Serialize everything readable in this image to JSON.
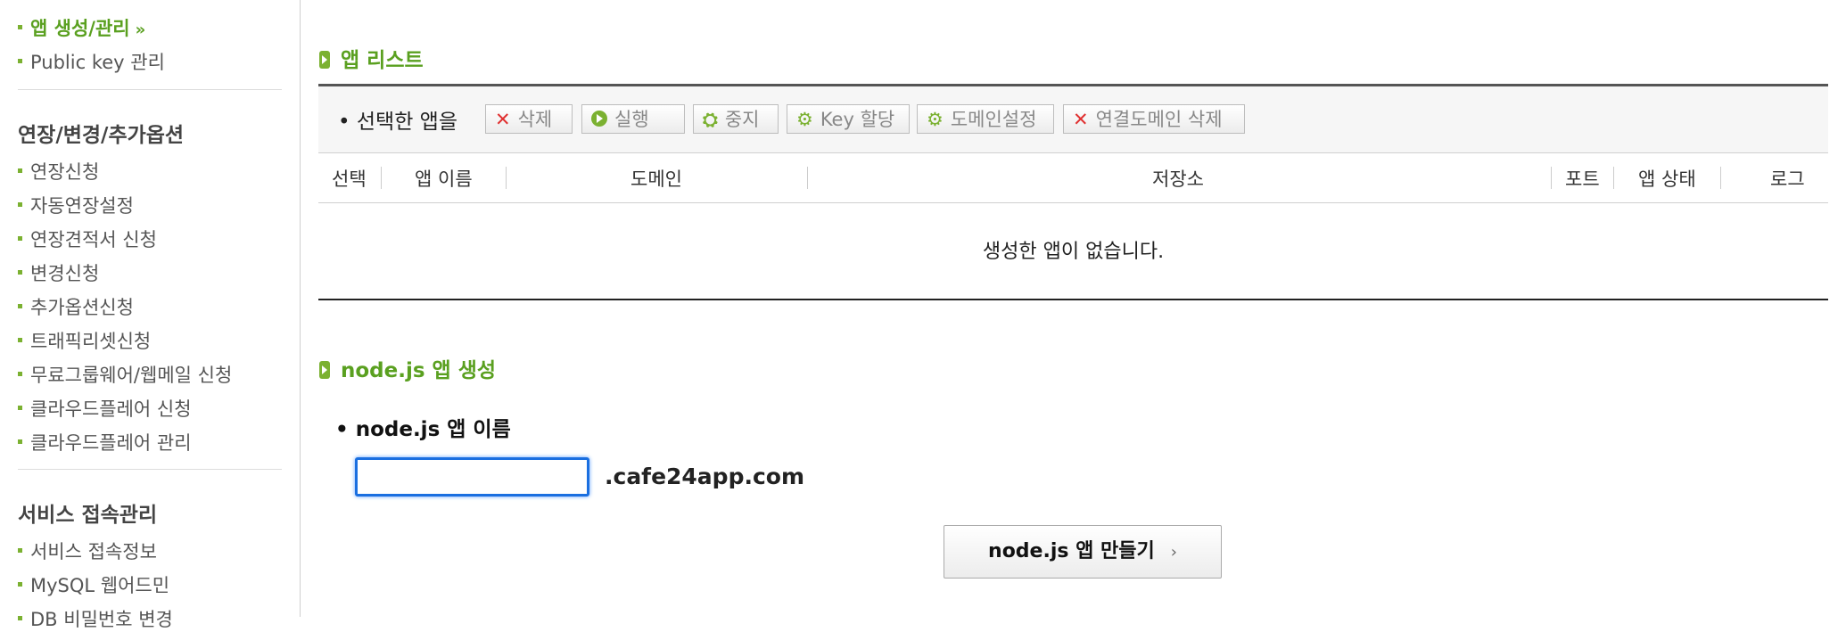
{
  "sidebar": {
    "items_top": [
      {
        "label": "앱 생성/관리",
        "active": true,
        "arrow": "»"
      },
      {
        "label": "Public key 관리",
        "active": false
      }
    ],
    "section2_title": "연장/변경/추가옵션",
    "section2_items": [
      {
        "label": "연장신청"
      },
      {
        "label": "자동연장설정"
      },
      {
        "label": "연장견적서 신청"
      },
      {
        "label": "변경신청"
      },
      {
        "label": "추가옵션신청"
      },
      {
        "label": "트래픽리셋신청"
      },
      {
        "label": "무료그룹웨어/웹메일 신청"
      },
      {
        "label": "클라우드플레어 신청"
      },
      {
        "label": "클라우드플레어 관리"
      }
    ],
    "section3_title": "서비스 접속관리",
    "section3_items": [
      {
        "label": "서비스 접속정보"
      },
      {
        "label": "MySQL 웹어드민"
      },
      {
        "label": "DB 비밀번호 변경"
      }
    ]
  },
  "app_list": {
    "title": "앱 리스트",
    "toolbar_label": "• 선택한 앱을",
    "buttons": {
      "delete": "삭제",
      "run": "실행",
      "stop": "중지",
      "key": "Key 할당",
      "domain": "도메인설정",
      "unlink": "연결도메인 삭제"
    },
    "columns": [
      "선택",
      "앱 이름",
      "도메인",
      "저장소",
      "포트",
      "앱 상태",
      "로그"
    ],
    "empty_message": "생성한 앱이 없습니다."
  },
  "create": {
    "title": "node.js 앱 생성",
    "field_label": "• node.js 앱 이름",
    "input_value": "",
    "domain_suffix": ".cafe24app.com",
    "button_label": "node.js 앱 만들기",
    "button_chevron": "›"
  },
  "colors": {
    "accent": "#5aa020",
    "focus": "#1a6fe0",
    "delete_icon": "#e03030"
  }
}
